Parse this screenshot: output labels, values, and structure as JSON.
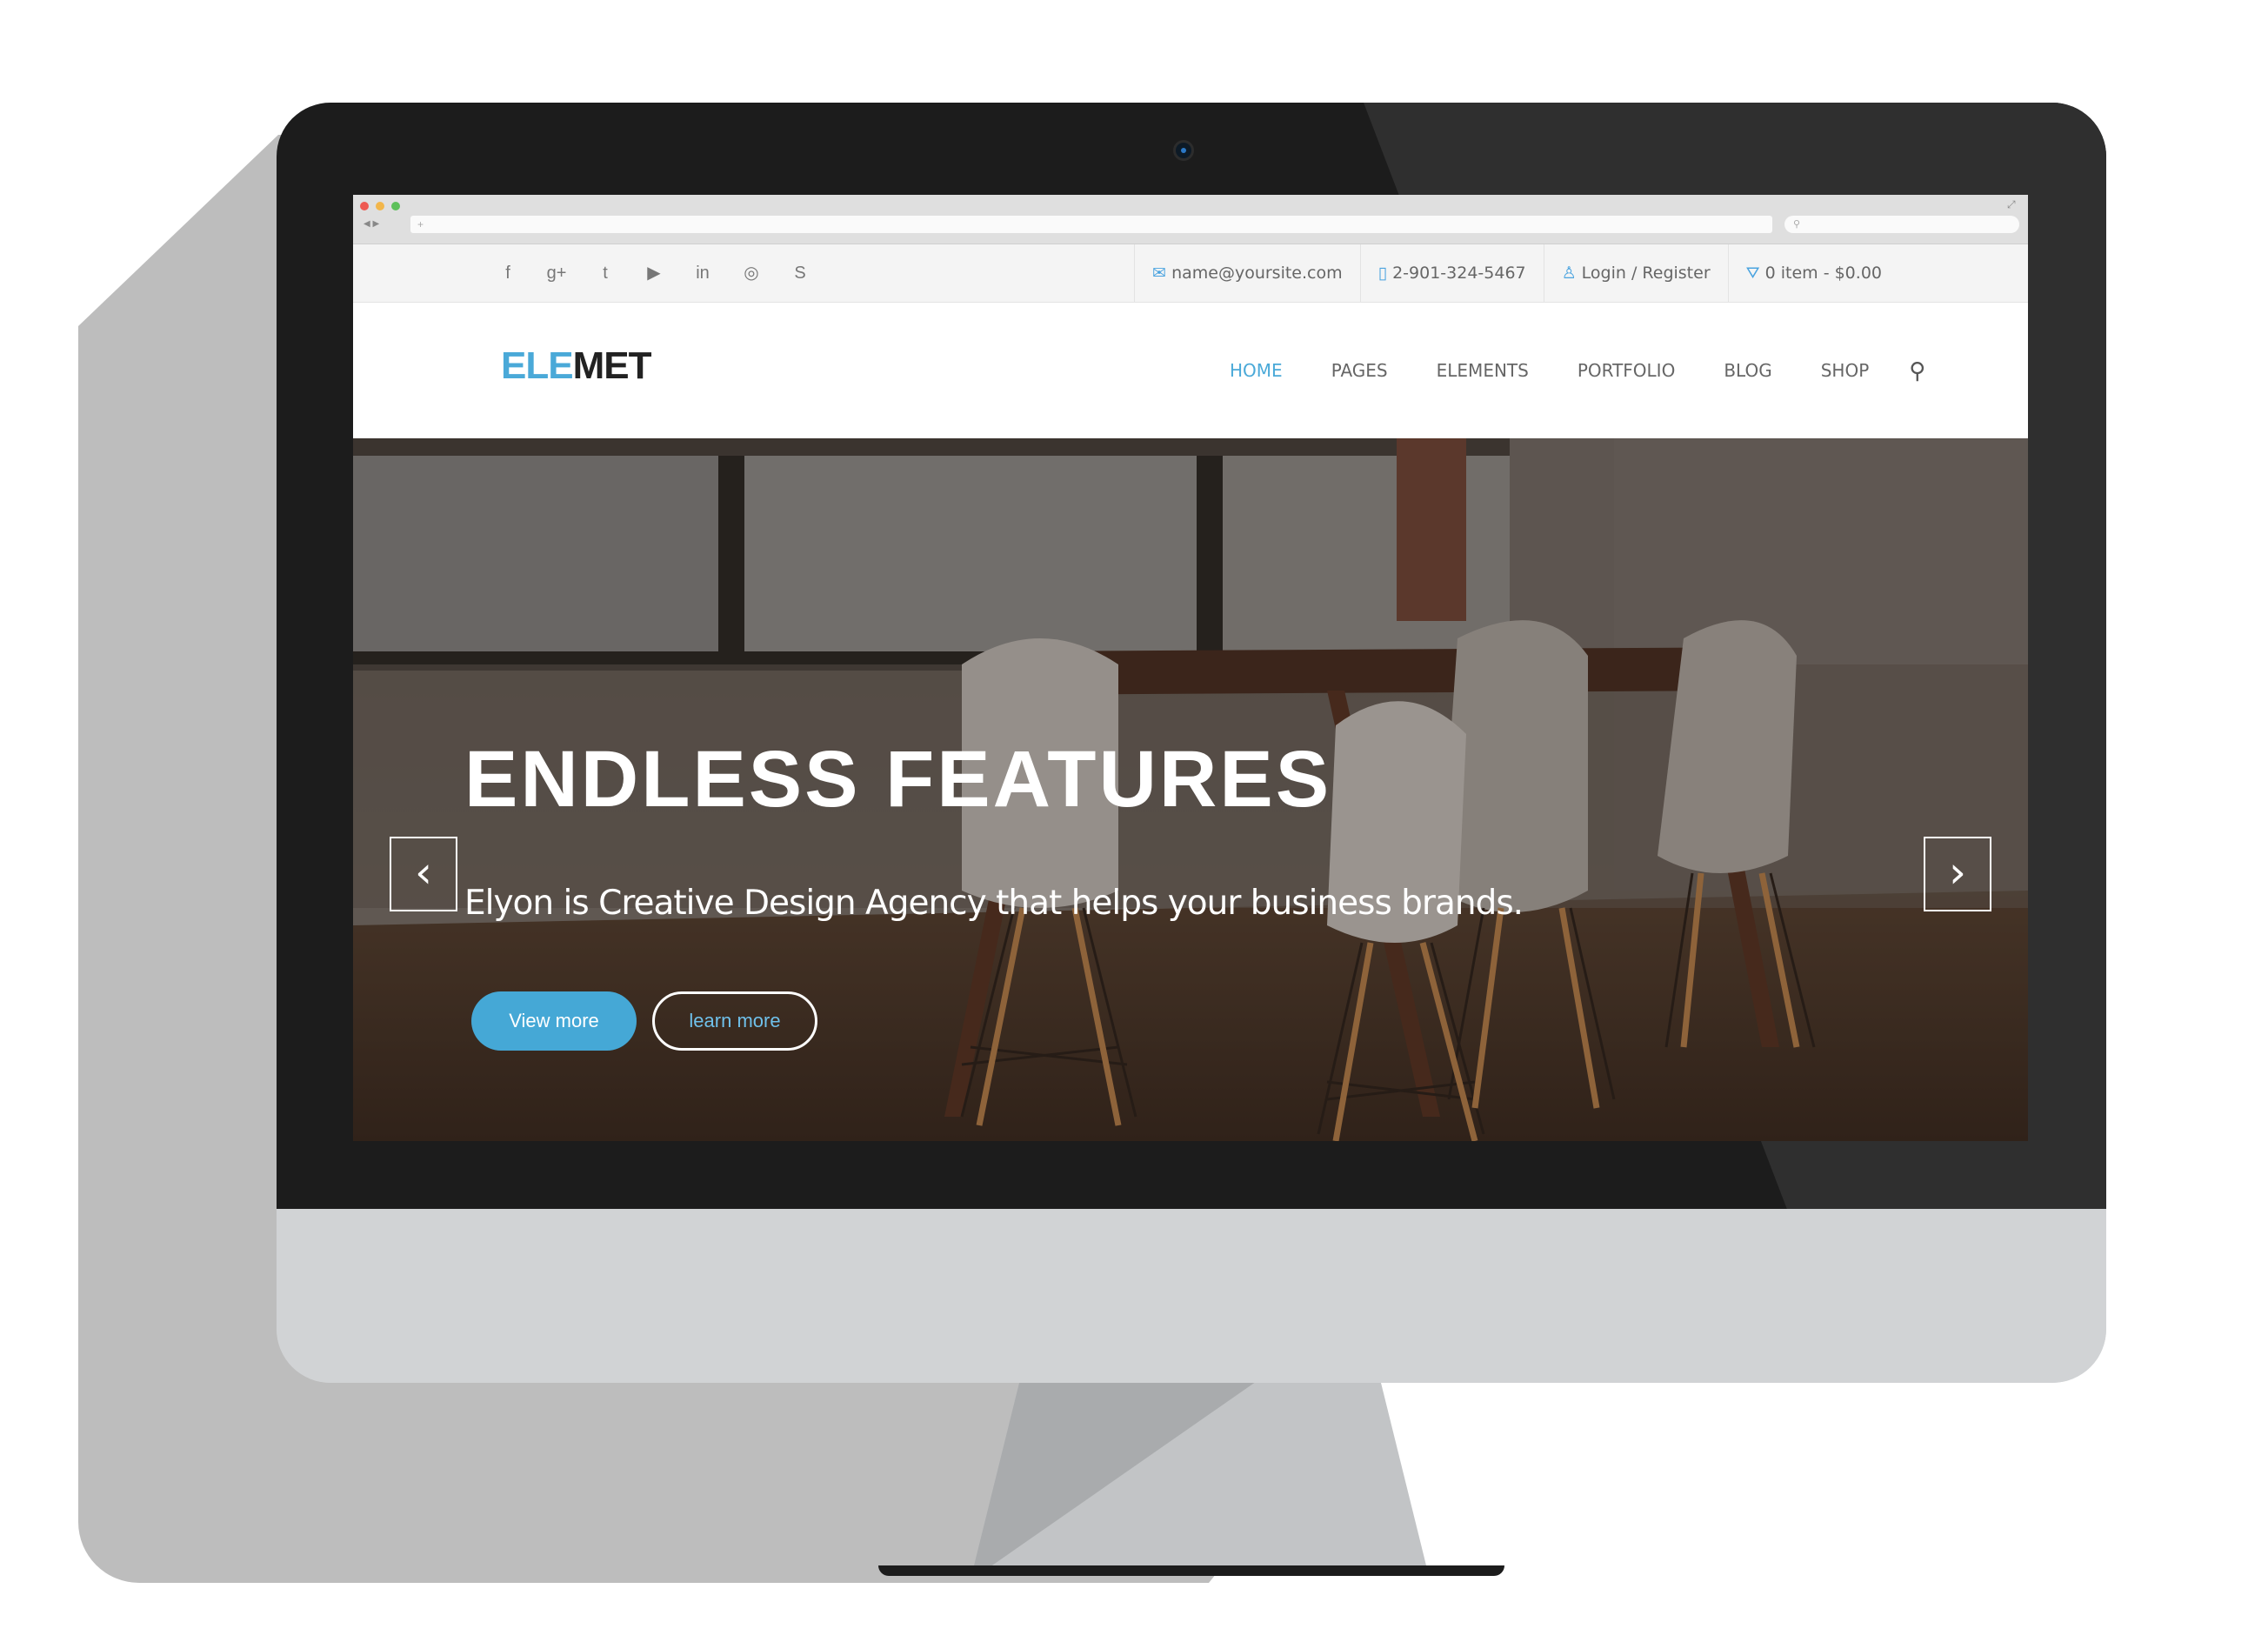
{
  "browser": {
    "url_placeholder": "+",
    "search_icon": "search-icon"
  },
  "topbar": {
    "social_icons": [
      "facebook-icon",
      "google-plus-icon",
      "twitter-icon",
      "youtube-icon",
      "linkedin-icon",
      "dribbble-icon",
      "skype-icon"
    ],
    "social_glyphs": [
      "f",
      "g+",
      "t",
      "▶",
      "in",
      "◎",
      "S"
    ],
    "email": "name@yoursite.com",
    "phone": "2-901-324-5467",
    "login": "Login / Register",
    "cart": "0 item - $0.00"
  },
  "nav": {
    "logo_part1": "ELE",
    "logo_part2": "MET",
    "items": [
      "HOME",
      "PAGES",
      "ELEMENTS",
      "PORTFOLIO",
      "BLOG",
      "SHOP"
    ],
    "active": "HOME"
  },
  "hero": {
    "title": "ENDLESS FEATURES",
    "subtitle": "Elyon is Creative Design Agency that helps your business brands.",
    "primary_button": "View more",
    "secondary_button": "learn more",
    "prev_arrow": "‹",
    "next_arrow": "›"
  },
  "colors": {
    "accent": "#4aa9d8",
    "bezel": "#1c1c1c",
    "chin": "#d1d3d5"
  }
}
